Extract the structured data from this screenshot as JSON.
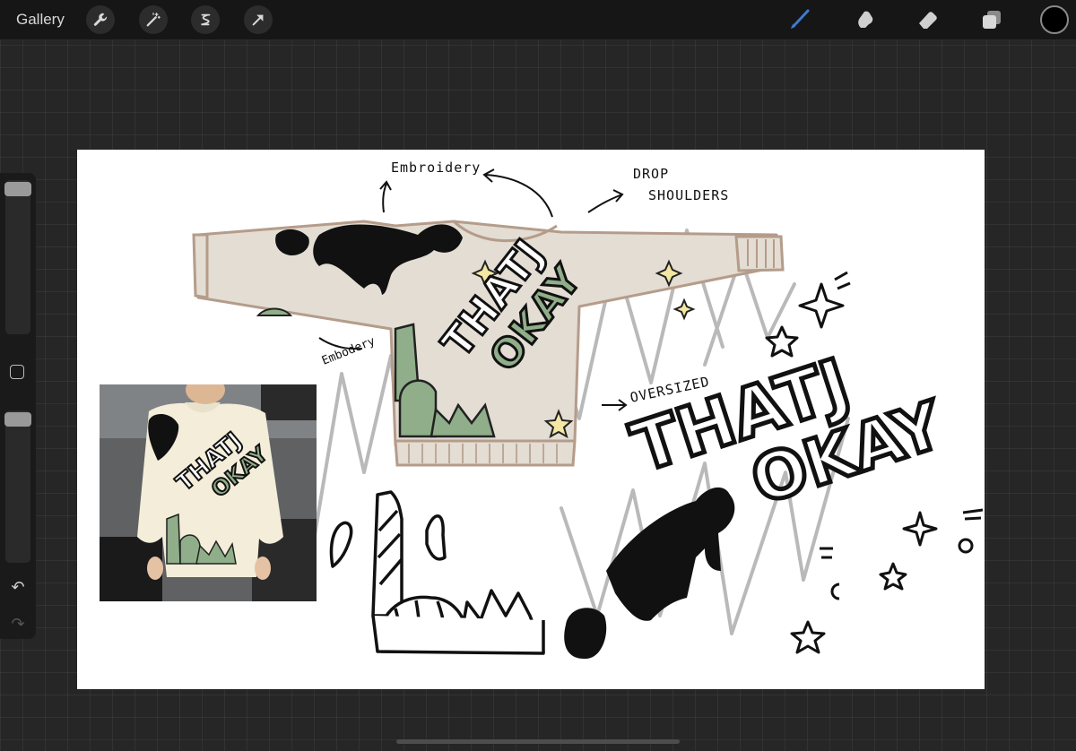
{
  "topbar": {
    "gallery_label": "Gallery",
    "left_tools": [
      "wrench-icon",
      "magic-wand-icon",
      "selection-icon",
      "transform-arrow-icon"
    ],
    "right_tools": [
      "brush-icon",
      "smudge-icon",
      "eraser-icon",
      "layers-icon"
    ],
    "active_tool": "brush-icon",
    "accent_color": "#3a7bd5",
    "current_color": "#000000"
  },
  "sidebar": {
    "items": [
      "brush-size-slider",
      "modify-button",
      "opacity-slider",
      "undo-icon",
      "redo-icon"
    ]
  },
  "canvas": {
    "annotations": {
      "embroidery_top": "Embroidery",
      "embroidery_side": "Embodery",
      "drop_shoulders_1": "DROP",
      "drop_shoulders_2": "SHOULDERS",
      "oversized": "OVERSIZED"
    },
    "graphic_text_1": "THATJ",
    "graphic_text_2": "OKAY",
    "sweater_color": "#e3ddd3",
    "accent_green": "#8fae89",
    "accent_yellow": "#f4e7a3"
  }
}
